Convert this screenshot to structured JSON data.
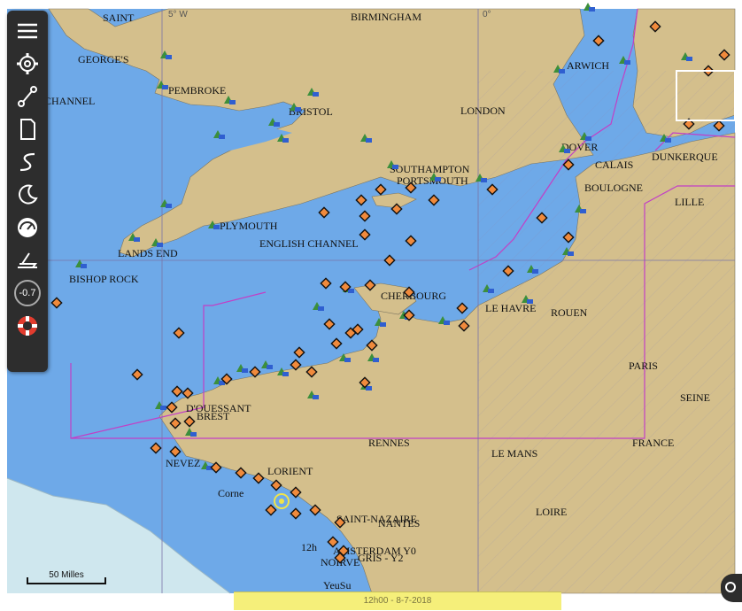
{
  "colors": {
    "sea": "#6ea9e8",
    "land": "#d4bf8c",
    "shallow": "#cfe7ee",
    "boundary": "#c23fc6",
    "grid": "#7a74a8",
    "marker": "#f08a3c",
    "toolbar_bg": "#2d2d2d",
    "timebar_bg": "#f5ef7a"
  },
  "grid_labels": {
    "lon_5w": "5° W",
    "lon_0": "0°"
  },
  "places": {
    "saint": "SAINT",
    "birmingham": "BIRMINGHAM",
    "georges": "GEORGE'S",
    "warwich": "ARWICH",
    "channel": "CHANNEL",
    "pembroke": "PEMBROKE",
    "bristol": "BRISTOL",
    "london": "LONDON",
    "dover": "DOVER",
    "calais": "CALAIS",
    "dunkerque": "DUNKERQUE",
    "southampton": "SOUTHAMPTON",
    "portsmouth": "PORTSMOUTH",
    "boulogne": "BOULOGNE",
    "lille": "LILLE",
    "plymouth": "PLYMOUTH",
    "english_channel": "ENGLISH CHANNEL",
    "lands_end": "LANDS END",
    "bishop_rock": "BISHOP ROCK",
    "cherbourg": "CHERBOURG",
    "le_havre": "LE HAVRE",
    "rouen": "ROUEN",
    "paris": "PARIS",
    "seine": "SEINE",
    "ouessant": "D'OUESSANT",
    "brest": "BREST",
    "rennes": "RENNES",
    "le_mans": "LE MANS",
    "france": "FRANCE",
    "lorient": "LORIENT",
    "nevez": "NEVEZ",
    "saint_nazaire": "SAINT-NAZAIRE",
    "nantes": "NANTES",
    "loire": "LOIRE",
    "corne": "Corne",
    "tide_12h": "12h",
    "amsterdam": "AMSTERDAM Y0",
    "gris": "GRIS - Y2",
    "noirve": "NOIRVE",
    "yeusu": "YeuSu"
  },
  "toolbar": [
    {
      "icon": "menu-icon"
    },
    {
      "icon": "gear-icon"
    },
    {
      "icon": "route-icon"
    },
    {
      "icon": "document-icon"
    },
    {
      "icon": "track-icon"
    },
    {
      "icon": "night-mode-icon"
    },
    {
      "icon": "gauge-icon"
    },
    {
      "icon": "boat-icon"
    },
    {
      "icon": "depth-icon",
      "value": "-0.7"
    },
    {
      "icon": "lifebuoy-icon"
    }
  ],
  "scale": {
    "label": "50 Milles"
  },
  "timebar": {
    "text": "12h00 - 8-7-2018"
  }
}
